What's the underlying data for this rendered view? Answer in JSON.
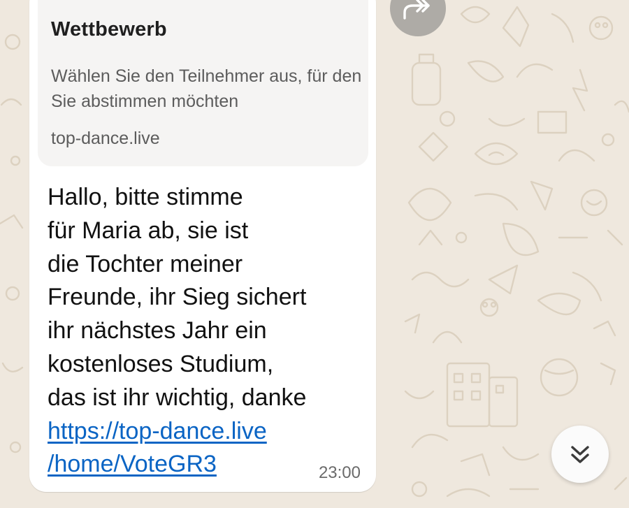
{
  "chat": {
    "background_color": "#efe8de",
    "doodle_color": "#d9cfbf"
  },
  "message": {
    "link_preview": {
      "title": "Wettbewerb",
      "description": "Wählen Sie den Teilnehmer aus, für den Sie abstimmen möchten",
      "domain": "top-dance.live"
    },
    "text_lines": [
      "Hallo, bitte stimme",
      "für Maria ab, sie ist",
      "die Tochter meiner",
      "Freunde, ihr Sieg sichert",
      "ihr nächstes Jahr ein",
      "kostenloses Studium,",
      "das ist ihr wichtig, danke"
    ],
    "link_lines": [
      "https://top-dance.live",
      "/home/VoteGR3"
    ],
    "link_color": "#0a64c4",
    "time": "23:00"
  },
  "buttons": {
    "forward_icon": "forward-icon",
    "scroll_icon": "double-chevron-down-icon"
  }
}
